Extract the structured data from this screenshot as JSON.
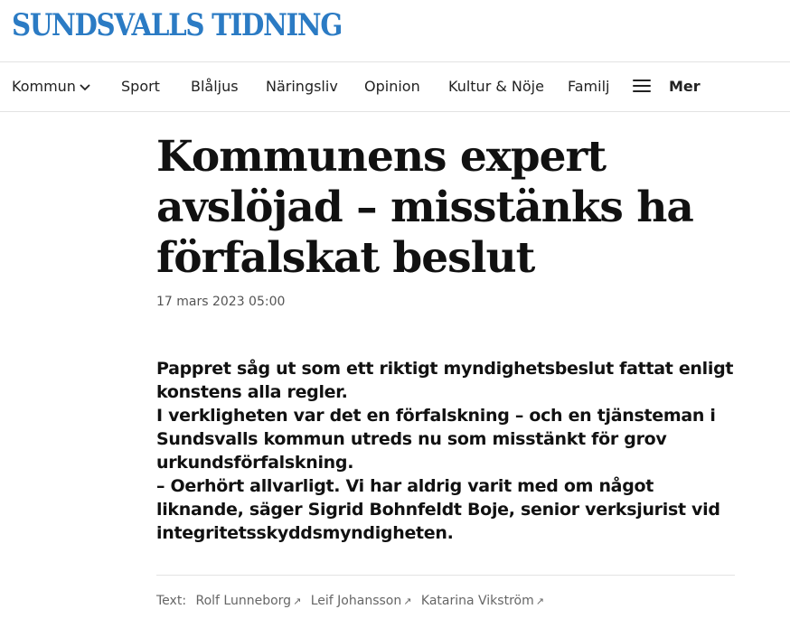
{
  "masthead": {
    "logo_text": "SUNDSVALLS TIDNING",
    "brand_color": "#2b7bc4"
  },
  "nav": {
    "items": [
      {
        "label": "Kommun",
        "has_dropdown": true
      },
      {
        "label": "Sport"
      },
      {
        "label": "Blåljus"
      },
      {
        "label": "Näringsliv"
      },
      {
        "label": "Opinion"
      },
      {
        "label": "Kultur & Nöje"
      },
      {
        "label": "Familj"
      }
    ],
    "more_label": "Mer"
  },
  "article": {
    "headline": "Kommunens expert avslöjad – misstänks ha förfalskat beslut",
    "published": "17 mars 2023 05:00",
    "lead": [
      "Pappret såg ut som ett riktigt myndighetsbeslut fattat enligt konstens alla regler.",
      "I verkligheten var det en förfalskning – och en tjänsteman i Sundsvalls kommun utreds nu som misstänkt för grov urkundsförfalskning.",
      "– Oerhört allvarligt. Vi har aldrig varit med om något liknande, säger Sigrid Bohnfeldt Boje, senior verksjurist vid integritetsskyddsmyndigheten."
    ],
    "byline_label": "Text:",
    "authors": [
      "Rolf Lunneborg",
      "Leif Johansson",
      "Katarina Vikström"
    ]
  }
}
